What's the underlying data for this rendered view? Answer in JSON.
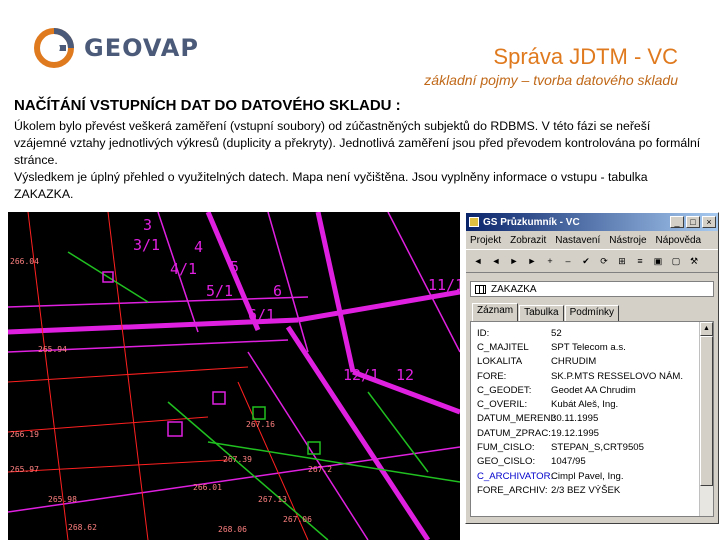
{
  "brand": {
    "name": "GEOVAP"
  },
  "header": {
    "title": "Správa JDTM - VC",
    "subtitle": "základní pojmy – tvorba datového skladu"
  },
  "content": {
    "heading": "NAČÍTÁNÍ VSTUPNÍCH DAT DO DATOVÉHO SKLADU :",
    "paragraph1": "Úkolem bylo převést veškerá zaměření (vstupní soubory) od zúčastněných subjektů do RDBMS. V této fázi se neřeší vzájemné vztahy jednotlivých výkresů (duplicity a překryty). Jednotlivá zaměření jsou před převodem kontrolována po formální stránce.",
    "paragraph2": "Výsledkem je úplný přehled o využitelných datech. Mapa není vyčištěna. Jsou vyplněny informace o vstupu - tabulka ZAKAZKA."
  },
  "map": {
    "labels": [
      "3",
      "3/1",
      "4",
      "4/1",
      "5",
      "5/1",
      "6",
      "6/1",
      "11/1",
      "12",
      "12/1",
      "265.94",
      "266.19",
      "265.97",
      "265.98",
      "267.16",
      "267.39",
      "266.01",
      "267.2",
      "266.04",
      "267.13",
      "267.06",
      "268.62",
      "268.06"
    ]
  },
  "window": {
    "title": "GS Průzkumník - VC",
    "controls": {
      "minimize": "_",
      "maximize": "□",
      "close": "×"
    },
    "menu": [
      "Projekt",
      "Zobrazit",
      "Nastavení",
      "Nástroje",
      "Nápověda"
    ],
    "toolbar": [
      "◄",
      "◄",
      "►",
      "►",
      "+",
      "–",
      "✔",
      "⟳",
      "⊞",
      "≡",
      "▣",
      "▢",
      "⚒"
    ],
    "table_name": "ZAKAZKA",
    "tabs": [
      "Záznam",
      "Tabulka",
      "Podmínky"
    ],
    "active_tab": "Záznam",
    "record": [
      {
        "key": "ID:",
        "value": "52"
      },
      {
        "key": "C_MAJITEL",
        "value": "SPT Telecom a.s."
      },
      {
        "key": "LOKALITA",
        "value": "CHRUDIM"
      },
      {
        "key": "FORE:",
        "value": "SK.P.MTS RESSELOVO NÁM."
      },
      {
        "key": "C_GEODET:",
        "value": "Geodet AA Chrudim"
      },
      {
        "key": "C_OVERIL:",
        "value": "Kubát Aleš, Ing."
      },
      {
        "key": "DATUM_MERENI:",
        "value": "30.11.1995"
      },
      {
        "key": "DATUM_ZPRAC:",
        "value": "19.12.1995"
      },
      {
        "key": "FUM_CISLO:",
        "value": "STEPAN_S,CRT9505"
      },
      {
        "key": "GEO_CISLO:",
        "value": "1047/95"
      },
      {
        "key": "C_ARCHIVATOR:",
        "value": "Cimpl Pavel, Ing."
      },
      {
        "key": "FORE_ARCHIV:",
        "value": "2/3 BEZ VÝŠEK"
      }
    ]
  }
}
